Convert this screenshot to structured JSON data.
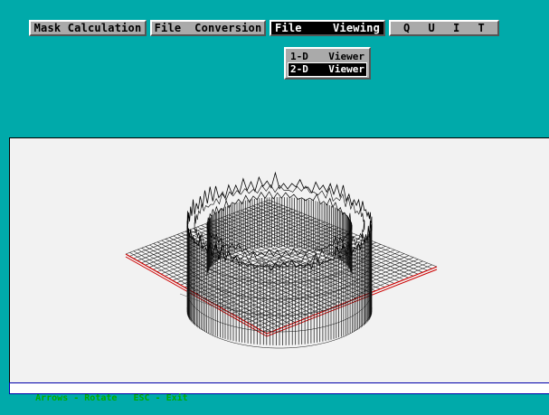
{
  "menu": {
    "mask_calculation": "Mask Calculation",
    "file_conversion": "File  Conversion",
    "file_viewing_left": "File",
    "file_viewing_right": "Viewing",
    "quit_letters": [
      "Q",
      "U",
      "I",
      "T"
    ]
  },
  "dropdown": {
    "items": [
      {
        "num": "1-D",
        "label": "Viewer",
        "selected": false
      },
      {
        "num": "2-D",
        "label": "Viewer",
        "selected": true
      }
    ]
  },
  "status": {
    "text": "Arrows - Rotate   ESC - Exit"
  },
  "colors": {
    "background": "#00aaaa",
    "canvas": "#f2f2f2",
    "status_text": "#00aa00",
    "base_edge": "#cc0000"
  }
}
